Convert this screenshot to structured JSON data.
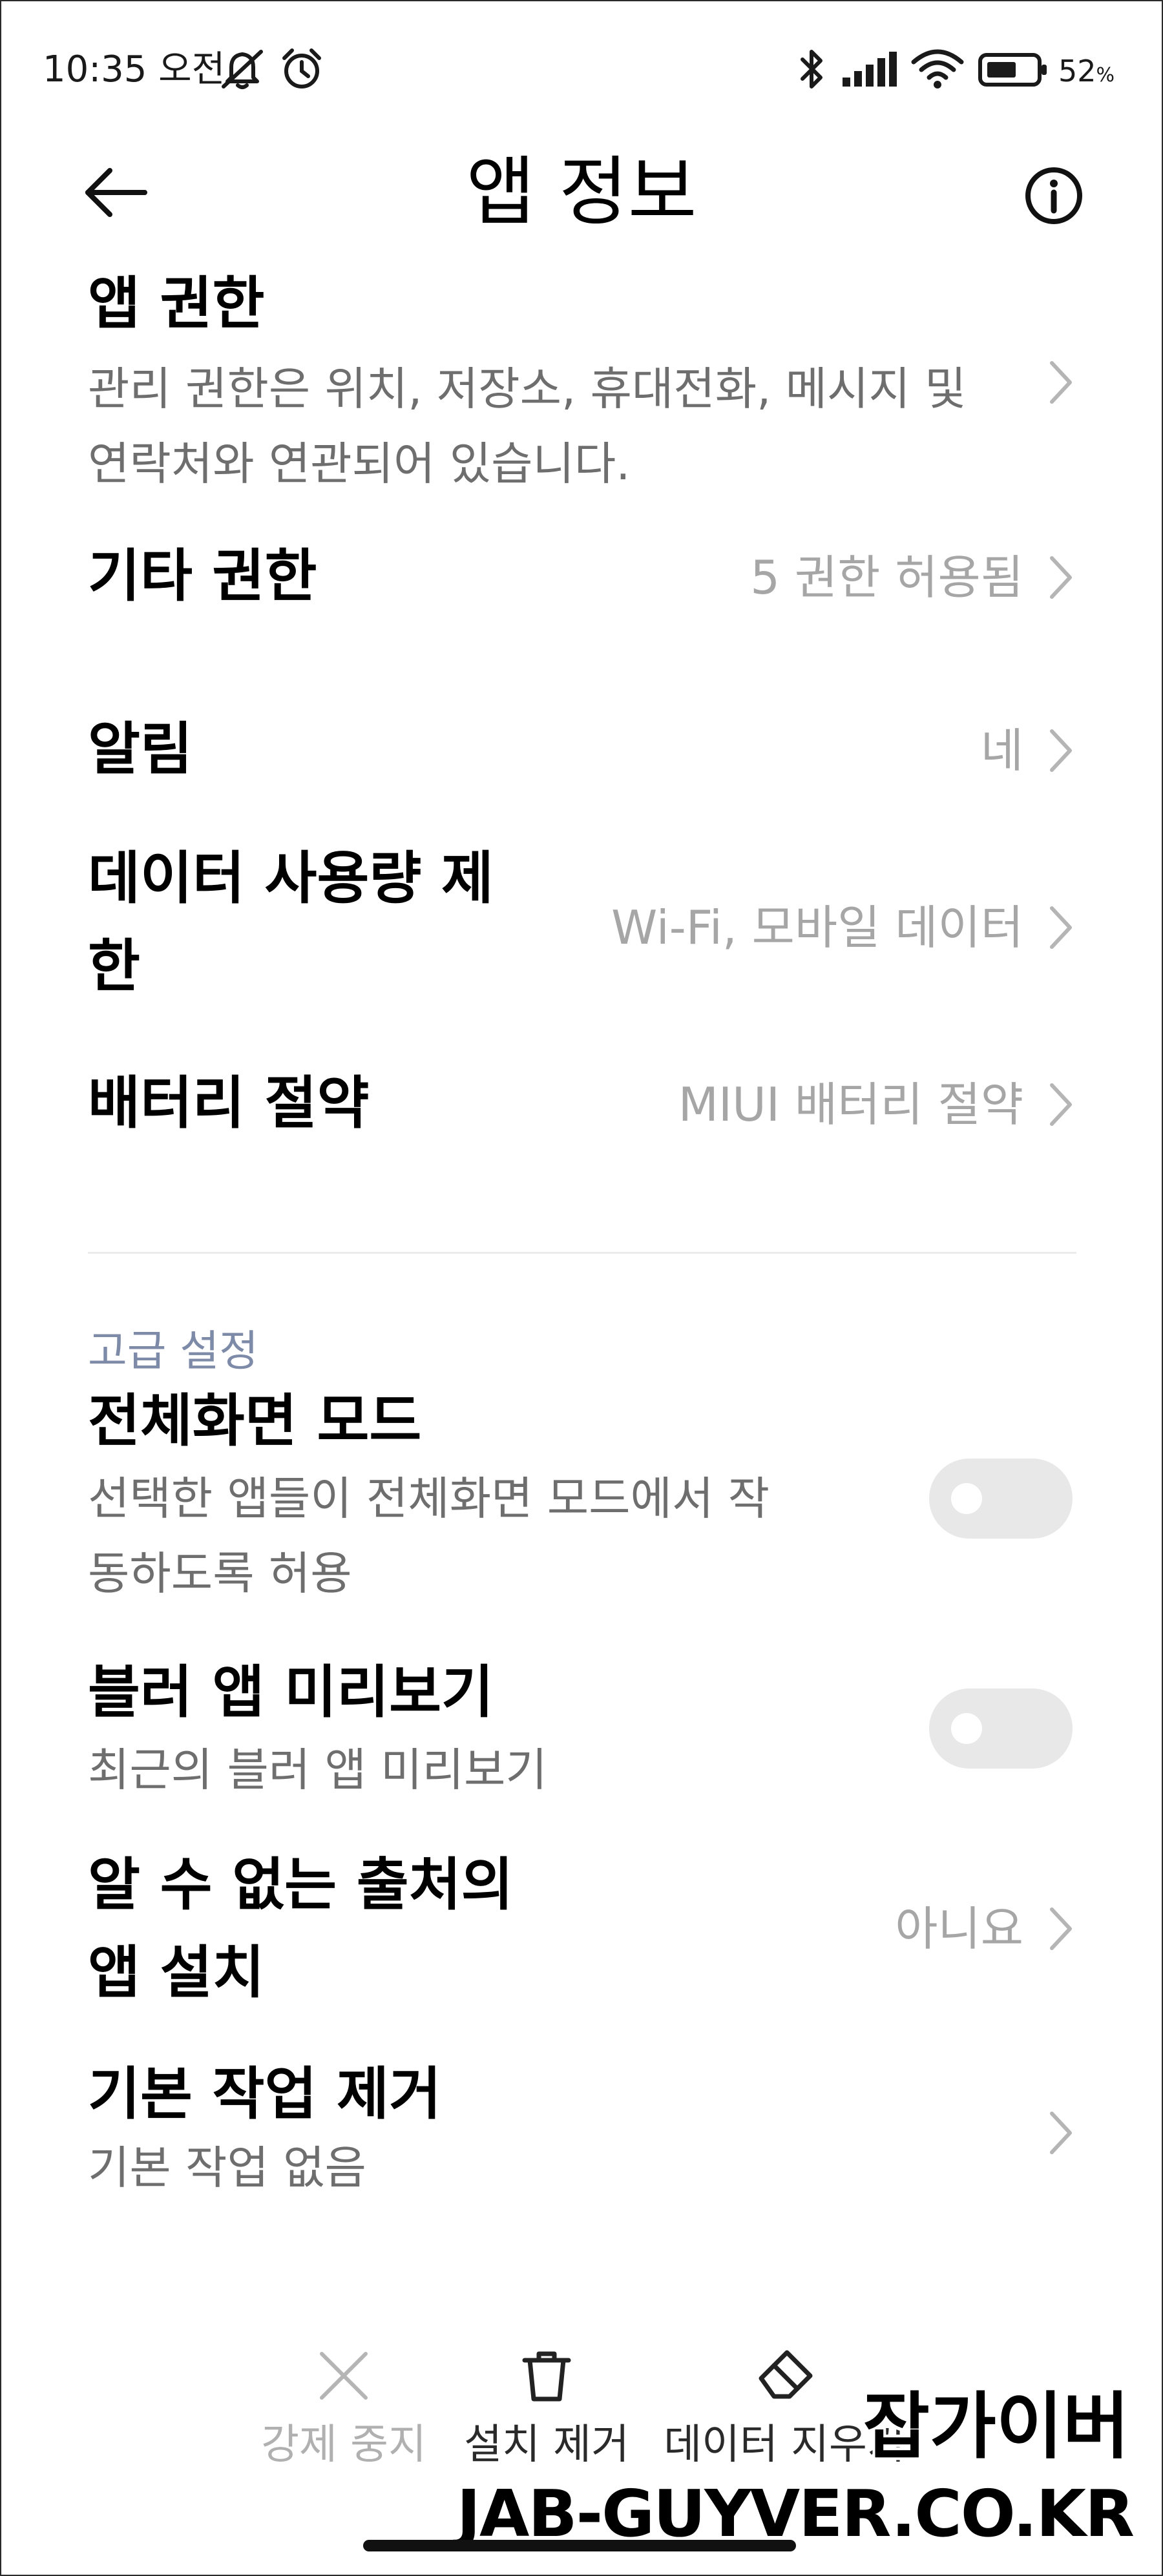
{
  "status_bar": {
    "time": "10:35 오전",
    "battery_percent": "52",
    "battery_unit": "%",
    "icons": [
      "mute-icon",
      "alarm-icon",
      "bluetooth-icon",
      "signal-icon",
      "wifi-icon",
      "battery-icon"
    ]
  },
  "header": {
    "title": "앱 정보",
    "back_icon": "back-arrow-icon",
    "info_icon": "info-icon"
  },
  "rows": {
    "app_permissions": {
      "title": "앱 권한",
      "sub_line1": "관리 권한은 위치, 저장소, 휴대전화, 메시지 및",
      "sub_line2": "연락처와 연관되어 있습니다."
    },
    "other_permissions": {
      "title": "기타 권한",
      "value": "5 권한 허용됨"
    },
    "notifications": {
      "title": "알림",
      "value": "네"
    },
    "data_usage": {
      "title_line1": "데이터 사용량 제",
      "title_line2": "한",
      "value": "Wi-Fi, 모바일 데이터"
    },
    "battery_saver": {
      "title": "배터리 절약",
      "value": "MIUI 배터리 절약"
    }
  },
  "advanced": {
    "section_label": "고급 설정",
    "fullscreen": {
      "title": "전체화면 모드",
      "sub_line1": "선택한 앱들이 전체화면 모드에서 작",
      "sub_line2": "동하도록 허용",
      "enabled": false
    },
    "blur_preview": {
      "title": "블러 앱 미리보기",
      "sub": "최근의 블러 앱 미리보기",
      "enabled": false
    },
    "unknown_sources": {
      "title_line1": "알 수 없는 출처의",
      "title_line2": "앱 설치",
      "value": "아니요"
    },
    "clear_defaults": {
      "title": "기본 작업 제거",
      "sub": "기본 작업 없음"
    }
  },
  "bottom_bar": {
    "force_stop": {
      "label": "강제 중지",
      "icon": "close-icon",
      "enabled": false
    },
    "uninstall": {
      "label": "설치 제거",
      "icon": "trash-icon",
      "enabled": true
    },
    "clear_data": {
      "label": "데이터 지우기",
      "icon": "eraser-icon",
      "enabled": true
    }
  },
  "watermark": {
    "line1": "잡가이버",
    "line2": "JAB-GUYVER.CO.KR"
  },
  "colors": {
    "title_text": "#000000",
    "secondary_text": "#6e6e6e",
    "value_text": "#a6a6a6",
    "section_header": "#7d8aa8",
    "toggle_off": "#e8e8e8",
    "disabled_text": "#b0b0b0"
  }
}
